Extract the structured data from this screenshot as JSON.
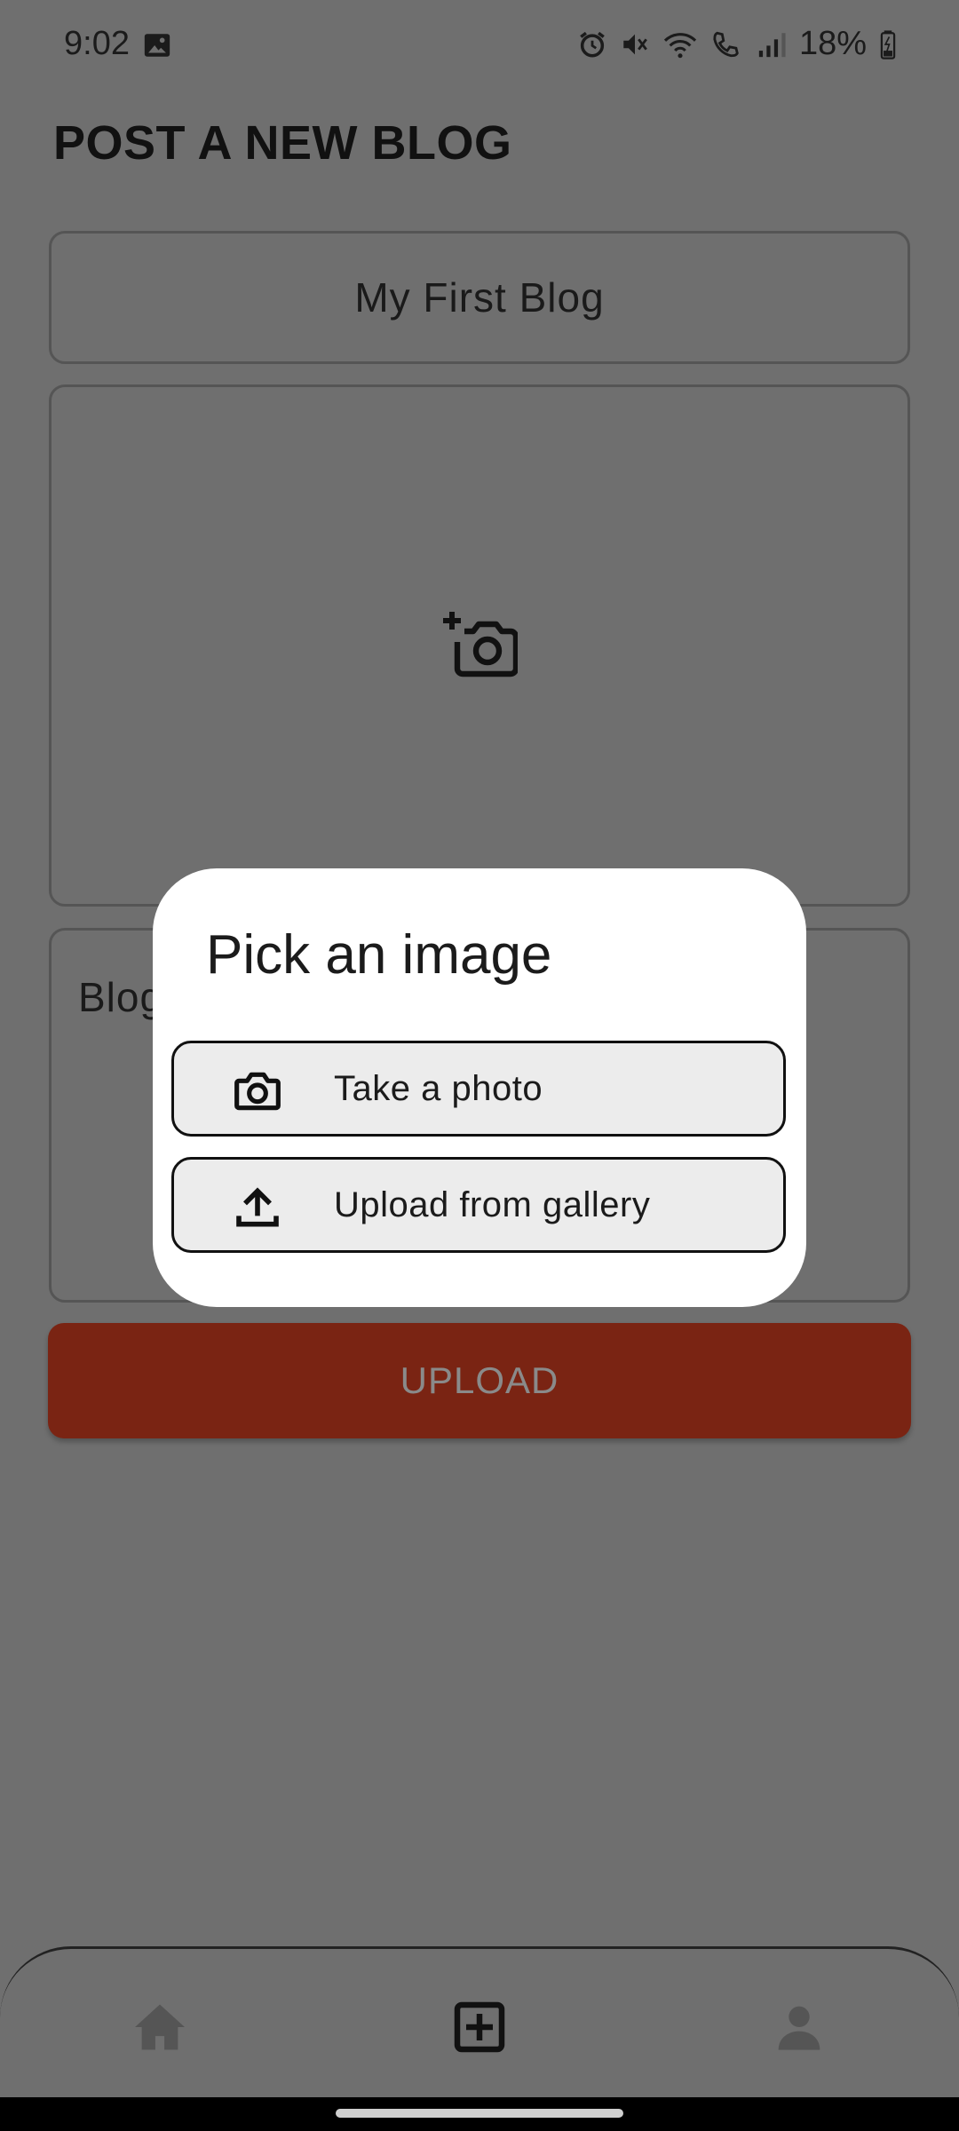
{
  "status_bar": {
    "time": "9:02",
    "battery": "18%"
  },
  "page": {
    "title": "POST A NEW BLOG"
  },
  "form": {
    "title_value": "My First Blog",
    "content_placeholder": "Blog",
    "upload_label": "UPLOAD"
  },
  "dialog": {
    "title": "Pick an image",
    "options": [
      {
        "label": "Take a photo",
        "icon": "camera-icon"
      },
      {
        "label": "Upload from gallery",
        "icon": "upload-icon"
      }
    ]
  },
  "nav": {
    "items": [
      {
        "name": "home",
        "icon": "home-icon"
      },
      {
        "name": "add-post",
        "icon": "add-box-icon"
      },
      {
        "name": "profile",
        "icon": "person-icon"
      }
    ]
  },
  "colors": {
    "upload_button": "#7a2413",
    "scrim_background": "#6f6f6f",
    "dialog_background": "#ffffff",
    "option_background": "#ececec"
  }
}
